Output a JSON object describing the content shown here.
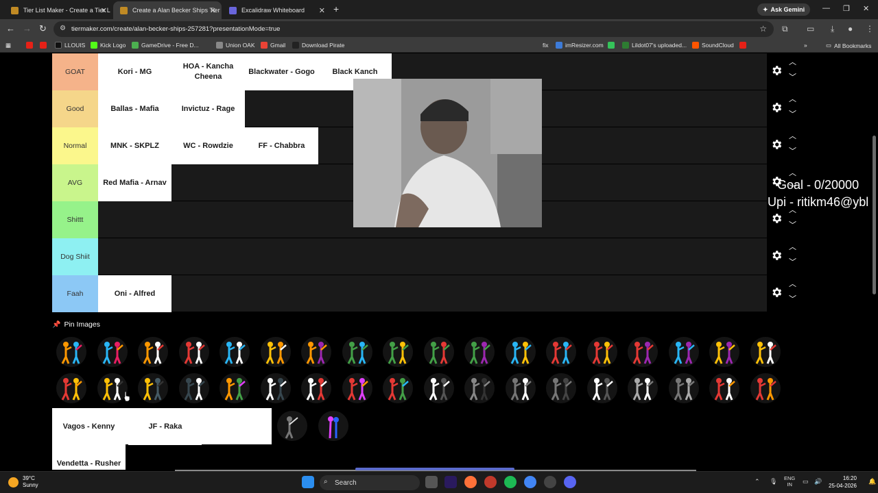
{
  "browser": {
    "tabs": [
      {
        "title": "Tier List Maker - Create a Tier L",
        "active": false
      },
      {
        "title": "Create a Alan Becker Ships Tier",
        "active": true
      },
      {
        "title": "Excalidraw Whiteboard",
        "active": false
      }
    ],
    "ask_gemini": "Ask Gemini",
    "url": "tiermaker.com/create/alan-becker-ships-257281?presentationMode=true",
    "bookmarks": [
      "LLOUIS",
      "Kick Logo",
      "GameDrive - Free D...",
      "Union OAK",
      "Gmail",
      "Download Pirate",
      "imResizer.com",
      "Lildot07's uploaded...",
      "SoundCloud"
    ],
    "bookmarks_fragment": "fix",
    "all_bookmarks": "All Bookmarks"
  },
  "tiers": [
    {
      "label": "GOAT",
      "color": "#f5b38a",
      "items": [
        "Kori - MG",
        "HOA - Kancha Cheena",
        "Blackwater - Gogo",
        "Black Kanch"
      ]
    },
    {
      "label": "Good",
      "color": "#f5d68a",
      "items": [
        "Ballas - Mafia",
        "Invictuz - Rage"
      ]
    },
    {
      "label": "Normal",
      "color": "#fbf78c",
      "items": [
        "MNK - SKPLZ",
        "WC - Rowdzie",
        "FF - Chabbra"
      ]
    },
    {
      "label": "AVG",
      "color": "#c9f58c",
      "items": [
        "Red Mafia - Arnav"
      ]
    },
    {
      "label": "Shittt",
      "color": "#96f28a",
      "items": []
    },
    {
      "label": "Dog Shiit",
      "color": "#8ef0f2",
      "items": []
    },
    {
      "label": "Faah",
      "color": "#8cc8f5",
      "items": [
        "Oni - Alfred"
      ]
    }
  ],
  "pin_images_label": "Pin Images",
  "pool_items": [
    "Vagos - Kenny",
    "JF - Raka",
    "Vendetta - Rusher"
  ],
  "overlay": {
    "goal": "Goal - 0/20000",
    "upi": "Upi - ritikm46@ybl"
  },
  "taskbar": {
    "temp": "39°C",
    "condition": "Sunny",
    "search": "Search",
    "lang_top": "ENG",
    "lang_bottom": "IN",
    "time": "16:20",
    "date": "25-04-2026"
  }
}
